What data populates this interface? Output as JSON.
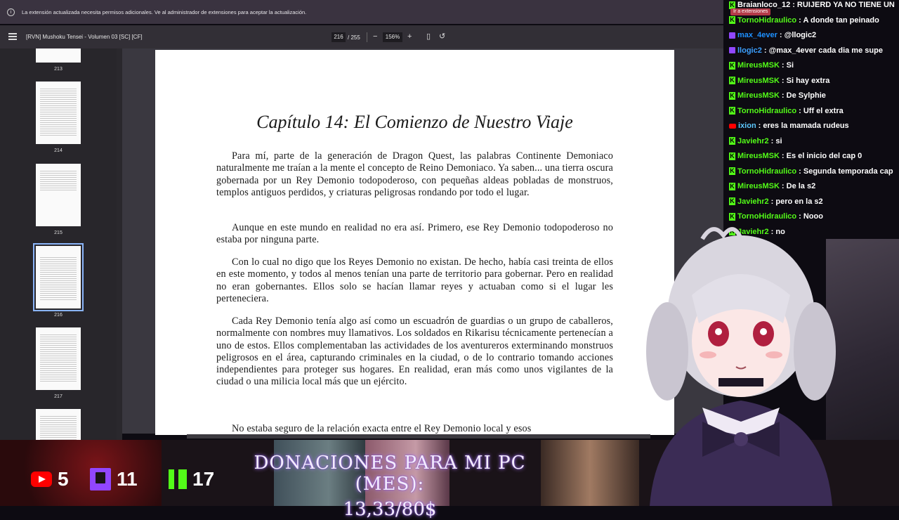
{
  "browser": {
    "infobar_text": "La extensión actualizada necesita permisos adicionales. Ve al administrador de extensiones para aceptar la actualización.",
    "ext_tooltip": "Ir a extensiones"
  },
  "pdf_toolbar": {
    "title": "[RVN] Mushoku Tensei - Volumen 03 [SC] [CF]",
    "current_page": "216",
    "total_pages": "/ 255",
    "zoom_out": "−",
    "zoom": "156%",
    "zoom_in": "+"
  },
  "thumbnails": [
    {
      "label": "213"
    },
    {
      "label": "214"
    },
    {
      "label": "215"
    },
    {
      "label": "216",
      "selected": true
    },
    {
      "label": "217"
    }
  ],
  "page": {
    "chapter_title": "Capítulo 14: El Comienzo de Nuestro Viaje",
    "paragraphs": [
      "Para mí, parte de la generación de Dragon Quest, las palabras Continente Demoniaco naturalmente me traían a la mente el concepto de Reino Demoniaco. Ya saben... una tierra oscura gobernada por un Rey Demonio todopoderoso, con pequeñas aldeas pobladas de monstruos, templos antiguos perdidos, y criaturas peligrosas rondando por todo el lugar.",
      "Aunque en este mundo en realidad no era así. Primero, ese Rey Demonio todopoderoso no estaba por ninguna parte.",
      "Con lo cual no digo que los Reyes Demonio no existan. De hecho, había casi treinta de ellos en este momento, y todos al menos tenían una parte de territorio para gobernar. Pero en realidad no eran gobernantes. Ellos solo se hacían llamar reyes y actuaban como si el lugar les perteneciera.",
      "Cada Rey Demonio tenía algo así como un escuadrón de guardias o un grupo de caballeros, normalmente con nombres muy llamativos. Los soldados en Rikarisu técnicamente pertenecían a uno de estos. Ellos complementaban las actividades de los aventureros exterminando monstruos peligrosos en el área, capturando criminales en la ciudad, o de lo contrario tomando acciones independientes para proteger sus hogares. En realidad, eran más como unos vigilantes de la ciudad o una milicia local más que un ejército.",
      "No estaba seguro de la relación exacta entre el Rey Demonio local y esos"
    ]
  },
  "chat": [
    {
      "badge": "kick",
      "user": "Braianloco_12",
      "user_color": "#ffffff",
      "msg": ": RUIJERD YA NO TIENE UN"
    },
    {
      "badge": "kick",
      "user": "TornoHidraulico",
      "user_color": "#53fc18",
      "msg": ": A donde tan peinado"
    },
    {
      "badge": "twitch",
      "user": "max_4ever",
      "user_color": "#1e90ff",
      "msg": ": @llogic2"
    },
    {
      "badge": "twitch",
      "user": "llogic2",
      "user_color": "#3ca0ff",
      "msg": ": @max_4ever cada dia me supe"
    },
    {
      "badge": "kick",
      "user": "MireusMSK",
      "user_color": "#53fc18",
      "msg": ": Si"
    },
    {
      "badge": "kick",
      "user": "MireusMSK",
      "user_color": "#53fc18",
      "msg": ": Si hay extra"
    },
    {
      "badge": "kick",
      "user": "MireusMSK",
      "user_color": "#53fc18",
      "msg": ": De Sylphie"
    },
    {
      "badge": "kick",
      "user": "TornoHidraulico",
      "user_color": "#53fc18",
      "msg": ": Uff el extra"
    },
    {
      "badge": "youtube",
      "user": "ixion",
      "user_color": "#5dc8ff",
      "msg": ": eres la mamada rudeus"
    },
    {
      "badge": "kick",
      "user": "Javiehr2",
      "user_color": "#53fc18",
      "msg": ": si"
    },
    {
      "badge": "kick",
      "user": "MireusMSK",
      "user_color": "#53fc18",
      "msg": ": Es el inicio del cap 0"
    },
    {
      "badge": "kick",
      "user": "TornoHidraulico",
      "user_color": "#53fc18",
      "msg": ": Segunda temporada cap"
    },
    {
      "badge": "kick",
      "user": "MireusMSK",
      "user_color": "#53fc18",
      "msg": ": De la s2"
    },
    {
      "badge": "kick",
      "user": "Javiehr2",
      "user_color": "#53fc18",
      "msg": ": pero en la s2"
    },
    {
      "badge": "kick",
      "user": "TornoHidraulico",
      "user_color": "#53fc18",
      "msg": ": Nooo"
    },
    {
      "badge": "kick",
      "user": "Javiehr2",
      "user_color": "#53fc18",
      "msg": ": no"
    }
  ],
  "stream": {
    "youtube_count": "5",
    "twitch_count": "11",
    "kick_count": "17",
    "donation_title": "DONACIONES PARA MI PC (MES):",
    "donation_amount": "13,33/80$"
  }
}
